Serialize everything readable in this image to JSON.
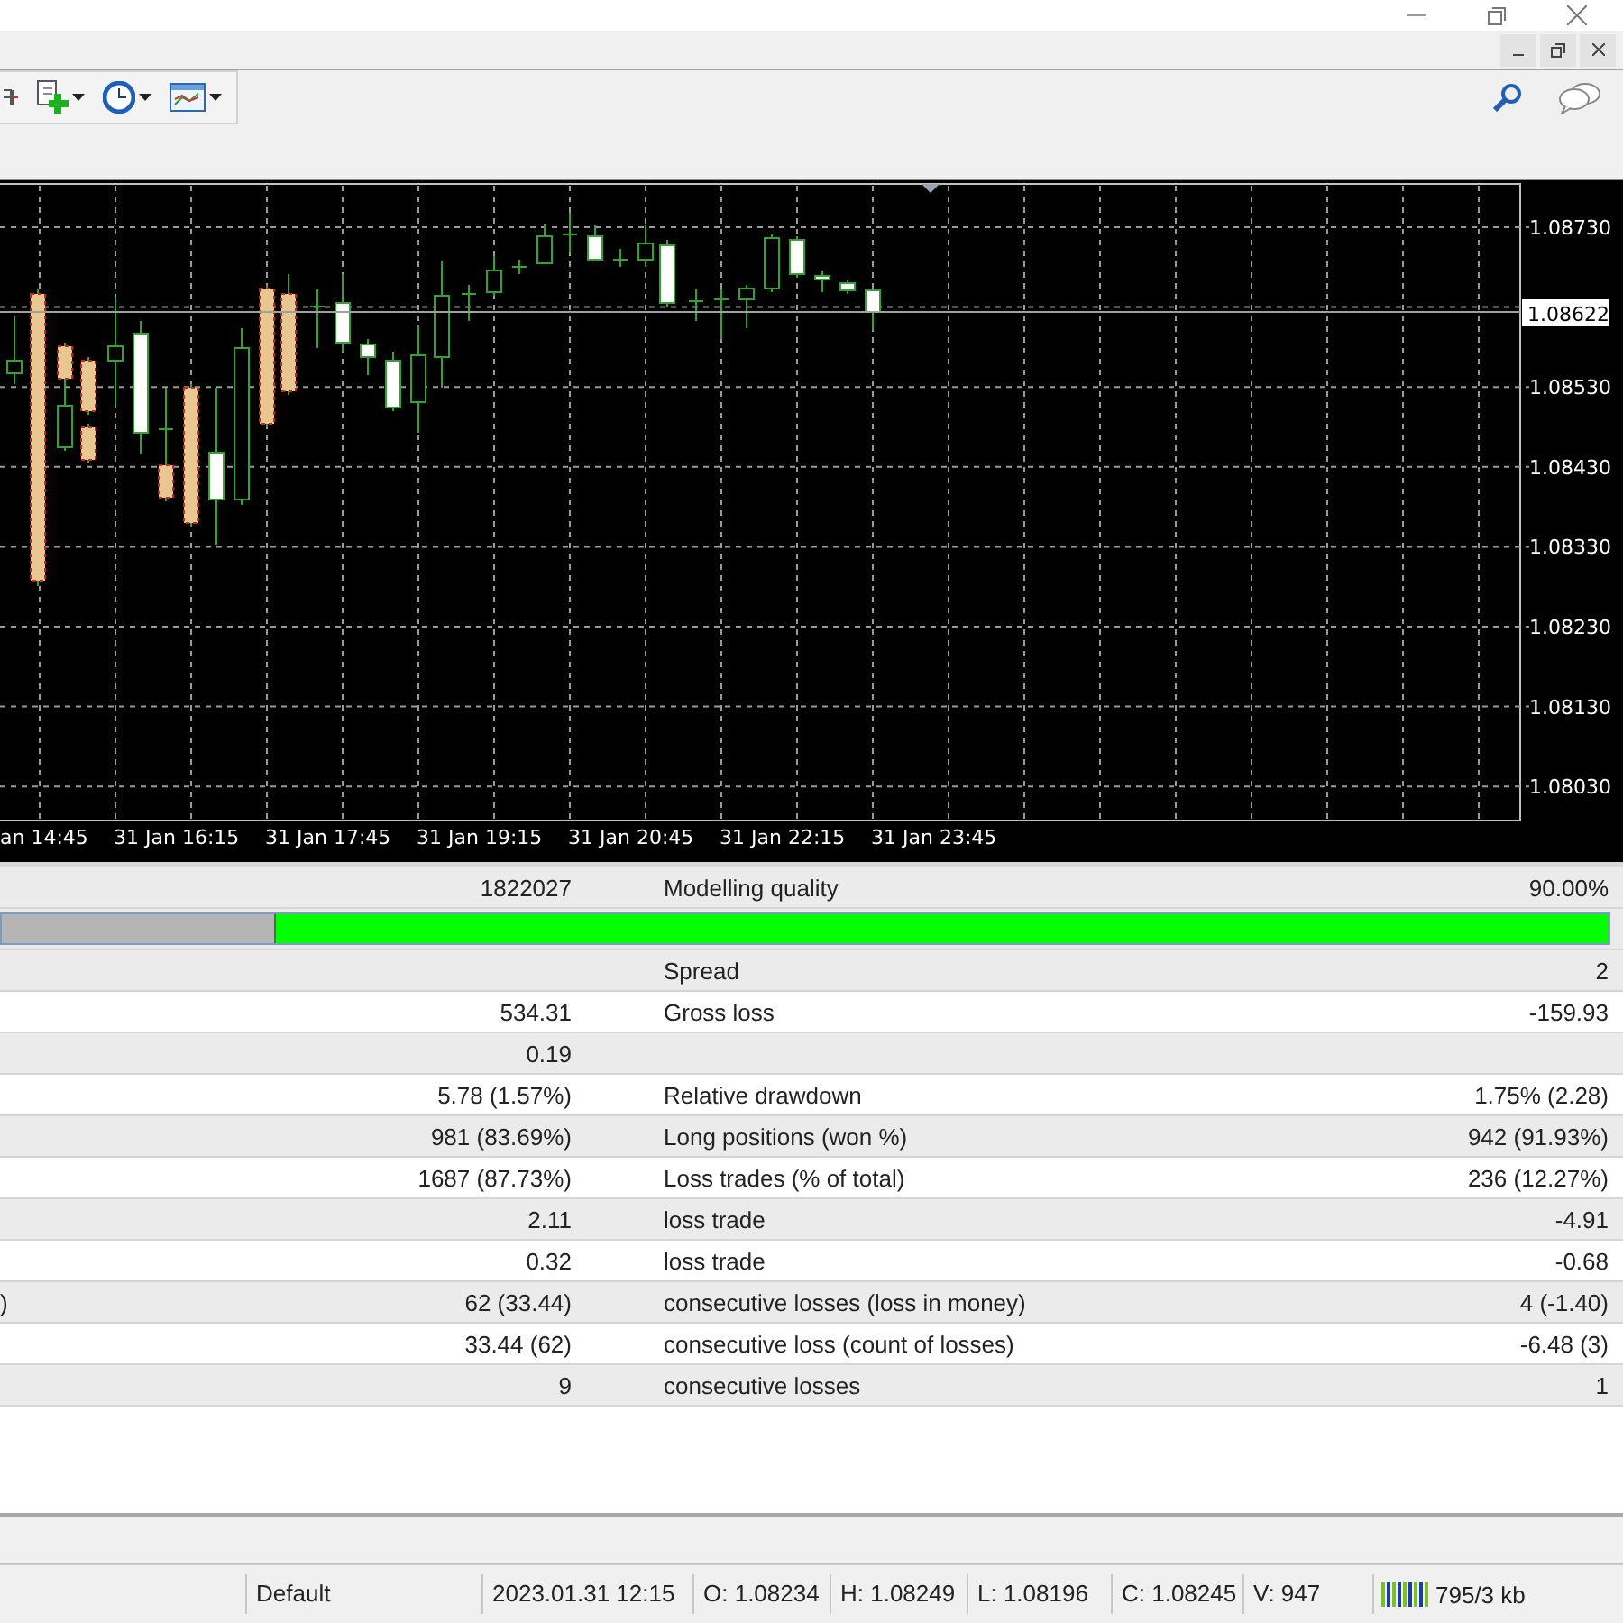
{
  "chart": {
    "price_labels": [
      "1.08730",
      "1.08530",
      "1.08430",
      "1.08330",
      "1.08230",
      "1.08130",
      "1.08030"
    ],
    "current_price": "1.08622",
    "time_labels": [
      "an 14:45",
      "31 Jan 16:15",
      "31 Jan 17:45",
      "31 Jan 19:15",
      "31 Jan 20:45",
      "31 Jan 22:15",
      "31 Jan 23:45"
    ]
  },
  "report": {
    "rows": [
      {
        "kind": "stat",
        "value_1": "1822027",
        "label_2": "Modelling quality",
        "value_2": "90.00%"
      },
      {
        "kind": "bar",
        "level": 0.83
      },
      {
        "kind": "stat",
        "label_2": "Spread",
        "value_2": "2"
      },
      {
        "kind": "stat",
        "value_1": "534.31",
        "label_2": "Gross loss",
        "value_2": "-159.93"
      },
      {
        "kind": "stat",
        "value_1": "0.19"
      },
      {
        "kind": "stat",
        "value_1": "5.78 (1.57%)",
        "label_2": "Relative drawdown",
        "value_2": "1.75% (2.28)"
      },
      {
        "kind": "stat",
        "value_1": "981 (83.69%)",
        "label_2": "Long positions (won %)",
        "value_2": "942 (91.93%)"
      },
      {
        "kind": "stat",
        "value_1": "1687 (87.73%)",
        "label_2": "Loss trades (% of total)",
        "value_2": "236 (12.27%)"
      },
      {
        "kind": "stat",
        "value_1": "2.11",
        "label_2": "loss trade",
        "value_2": "-4.91"
      },
      {
        "kind": "stat",
        "value_1": "0.32",
        "label_2": "loss trade",
        "value_2": "-0.68"
      },
      {
        "kind": "stat",
        "label_1": ")",
        "value_1": "62 (33.44)",
        "label_2": "consecutive losses (loss in money)",
        "value_2": "4 (-1.40)"
      },
      {
        "kind": "stat",
        "value_1": "33.44 (62)",
        "label_2": "consecutive loss (count of losses)",
        "value_2": "-6.48 (3)"
      },
      {
        "kind": "stat",
        "value_1": "9",
        "label_2": "consecutive losses",
        "value_2": "1"
      }
    ]
  },
  "status_bar": {
    "profile": "Default",
    "fields": [
      "2023.01.31 12:15",
      "O: 1.08234",
      "H: 1.08249",
      "L: 1.08196",
      "C: 1.08245",
      "V: 947"
    ],
    "memory": "795/3 kb"
  }
}
